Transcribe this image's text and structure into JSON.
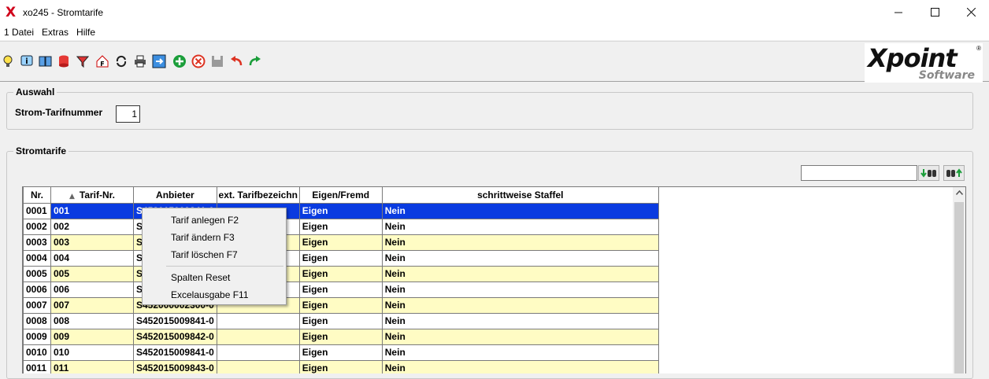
{
  "window": {
    "title": "xo245 - Stromtarife",
    "app_icon": "X",
    "controls": [
      "minimize-icon",
      "maximize-icon",
      "close-icon"
    ]
  },
  "menubar": {
    "items": [
      "1 Datei",
      "Extras",
      "Hilfe"
    ]
  },
  "toolbar": {
    "icons": [
      "lightbulb-icon",
      "info-icon",
      "book-icon",
      "database-icon",
      "filter-icon",
      "home-icon",
      "refresh-icon",
      "print-icon",
      "export-icon",
      "add-icon",
      "delete-icon",
      "save-icon",
      "undo-icon",
      "redo-icon"
    ]
  },
  "logo": {
    "main": "Xpoint",
    "sub": "Software",
    "reg": "®"
  },
  "auswahl": {
    "legend": "Auswahl",
    "field_label": "Strom-Tarifnummer",
    "field_value": "1"
  },
  "stromtarife": {
    "legend": "Stromtarife",
    "search_value": "",
    "search_down_icon": "find-next-icon",
    "search_up_icon": "find-prev-icon"
  },
  "table": {
    "columns": [
      "Nr.",
      "Tarif-Nr.",
      "Anbieter",
      "ext. Tarifbezeichn",
      "Eigen/Fremd",
      "schrittweise Staffel"
    ],
    "sort_indicator": "sort-ascending-icon",
    "rows": [
      {
        "nr": "0001",
        "tarif": "001",
        "anbieter": "S452015009841-0",
        "ext": "",
        "eigen": "Eigen",
        "staffel": "Nein"
      },
      {
        "nr": "0002",
        "tarif": "002",
        "anbieter": "S4",
        "ext": "",
        "eigen": "Eigen",
        "staffel": "Nein"
      },
      {
        "nr": "0003",
        "tarif": "003",
        "anbieter": "S4",
        "ext": "",
        "eigen": "Eigen",
        "staffel": "Nein"
      },
      {
        "nr": "0004",
        "tarif": "004",
        "anbieter": "S4",
        "ext": "",
        "eigen": "Eigen",
        "staffel": "Nein"
      },
      {
        "nr": "0005",
        "tarif": "005",
        "anbieter": "S4",
        "ext": "",
        "eigen": "Eigen",
        "staffel": "Nein"
      },
      {
        "nr": "0006",
        "tarif": "006",
        "anbieter": "S4",
        "ext": "",
        "eigen": "Eigen",
        "staffel": "Nein"
      },
      {
        "nr": "0007",
        "tarif": "007",
        "anbieter": "S452000002300-0",
        "ext": "",
        "eigen": "Eigen",
        "staffel": "Nein"
      },
      {
        "nr": "0008",
        "tarif": "008",
        "anbieter": "S452015009841-0",
        "ext": "",
        "eigen": "Eigen",
        "staffel": "Nein"
      },
      {
        "nr": "0009",
        "tarif": "009",
        "anbieter": "S452015009842-0",
        "ext": "",
        "eigen": "Eigen",
        "staffel": "Nein"
      },
      {
        "nr": "0010",
        "tarif": "010",
        "anbieter": "S452015009841-0",
        "ext": "",
        "eigen": "Eigen",
        "staffel": "Nein"
      },
      {
        "nr": "0011",
        "tarif": "011",
        "anbieter": "S452015009843-0",
        "ext": "",
        "eigen": "Eigen",
        "staffel": "Nein"
      }
    ]
  },
  "context_menu": {
    "items": [
      "Tarif anlegen F2",
      "Tarif ändern F3",
      "Tarif löschen F7",
      "Spalten Reset",
      "Excelausgabe F11"
    ]
  },
  "colors": {
    "selection": "#0a3be0",
    "row_yellow": "#fffcc4",
    "app_icon": "#d0021b"
  }
}
